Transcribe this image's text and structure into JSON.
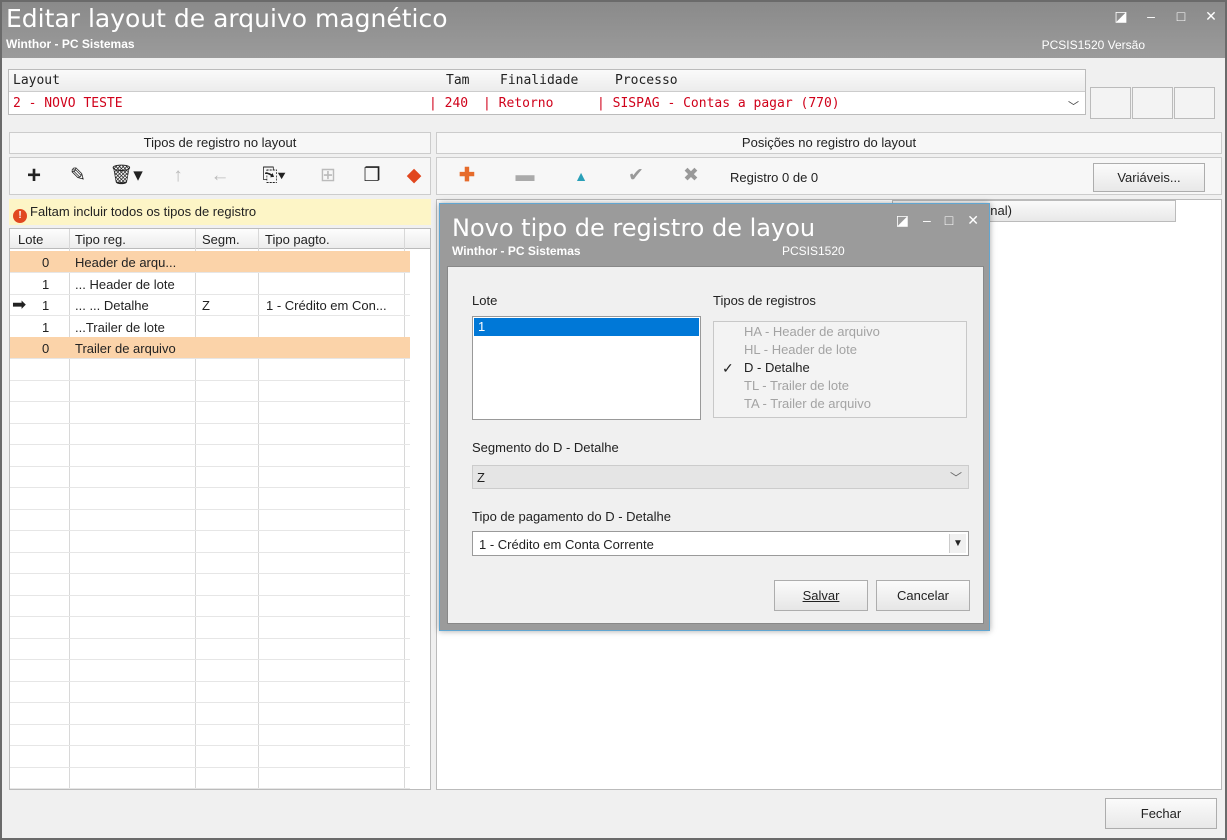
{
  "window": {
    "title": "Editar layout de arquivo magnético",
    "subtitle": "Winthor - PC Sistemas",
    "code": "PCSIS1520  Versão"
  },
  "layout": {
    "headers": {
      "layout": "Layout",
      "tam": "Tam",
      "finalidade": "Finalidade",
      "processo": "Processo"
    },
    "row": {
      "layout": "2 - NOVO TESTE",
      "tam": "| 240",
      "finalidade": "| Retorno",
      "processo": "| SISPAG - Contas a pagar (770)"
    }
  },
  "left_panel": {
    "title": "Tipos de registro no layout",
    "warning": "Faltam incluir todos os tipos de registro",
    "columns": {
      "lote": "Lote",
      "tipo": "Tipo reg.",
      "segm": "Segm.",
      "pagto": "Tipo pagto."
    },
    "rows": [
      {
        "lote": "0",
        "tipo": "Header de arqu...",
        "segm": "",
        "pagto": "",
        "highlight": true,
        "current": false
      },
      {
        "lote": "1",
        "tipo": "... Header de lote",
        "segm": "",
        "pagto": "",
        "highlight": false,
        "current": false
      },
      {
        "lote": "1",
        "tipo": "... ... Detalhe",
        "segm": "Z",
        "pagto": "1 - Crédito em Con...",
        "highlight": false,
        "current": true
      },
      {
        "lote": "1",
        "tipo": "...Trailer de lote",
        "segm": "",
        "pagto": "",
        "highlight": false,
        "current": false
      },
      {
        "lote": "0",
        "tipo": "Trailer de arquivo",
        "segm": "",
        "pagto": "",
        "highlight": true,
        "current": false
      }
    ]
  },
  "right_panel": {
    "title": "Posições no registro do layout",
    "registro": "Registro 0 de 0",
    "variaveis": "Variáveis...",
    "partial_header": "onal)"
  },
  "footer": {
    "fechar": "Fechar"
  },
  "dialog": {
    "title": "Novo tipo de registro de layou",
    "subtitle": "Winthor - PC Sistemas",
    "code": "PCSIS1520",
    "lote_label": "Lote",
    "lote_selected": "1",
    "tipos_label": "Tipos de registros",
    "tipos": [
      {
        "label": "HA - Header de arquivo",
        "active": false
      },
      {
        "label": "HL - Header de lote",
        "active": false
      },
      {
        "label": "D - Detalhe",
        "active": true
      },
      {
        "label": "TL - Trailer de lote",
        "active": false
      },
      {
        "label": "TA - Trailer de arquivo",
        "active": false
      }
    ],
    "segmento_label": "Segmento do D - Detalhe",
    "segmento_value": "Z",
    "pagamento_label": "Tipo de pagamento do D - Detalhe",
    "pagamento_value": "1 - Crédito em Conta Corrente",
    "salvar": "Salvar",
    "cancelar": "Cancelar"
  }
}
